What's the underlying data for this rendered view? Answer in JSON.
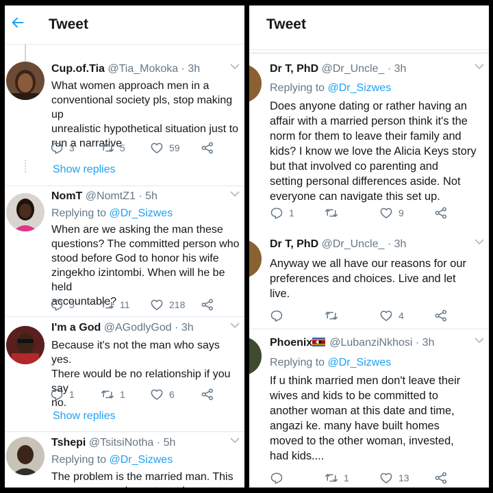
{
  "left": {
    "header": {
      "title": "Tweet"
    },
    "show_replies_label": "Show replies",
    "tweets": [
      {
        "name": "Cup.of.Tia",
        "handle": "@Tia_Mokoka",
        "time": "3h",
        "text": "What women approach men in a\nconventional society pls, stop making up\nunrealistic hypothetical situation just to\nrun a narrative",
        "replies": "3",
        "retweets": "5",
        "likes": "59"
      },
      {
        "name": "NomT",
        "handle": "@NomtZ1",
        "time": "5h",
        "replying_to": "Replying to",
        "reply_handle": "@Dr_Sizwes",
        "text": "When are we asking the man these\nquestions? The committed person who\nstood before God to honor his wife\nzingekho izintombi. When will he be held\naccountable?",
        "replies": "5",
        "retweets": "11",
        "likes": "218"
      },
      {
        "name": "I'm a God",
        "handle": "@AGodlyGod",
        "time": "3h",
        "text": "Because it's not the man who says yes.\nThere would be no relationship if you say\nno.",
        "replies": "1",
        "retweets": "1",
        "likes": "6"
      },
      {
        "name": "Tshepi",
        "handle": "@TsitsiNotha",
        "time": "5h",
        "replying_to": "Replying to",
        "reply_handle": "@Dr_Sizwes",
        "text": "The problem is the married man. This\nman are never honest, not honest to"
      }
    ]
  },
  "right": {
    "header": {
      "title": "Tweet"
    },
    "tweets": [
      {
        "name": "Dr T, PhD",
        "handle": "@Dr_Uncle_",
        "time": "3h",
        "replying_to": "Replying to",
        "reply_handle": "@Dr_Sizwes",
        "text": "Does anyone dating or rather having an\naffair with a married person think it's the\nnorm for them to leave their family and\nkids? I know we love the Alicia Keys story\nbut that involved co parenting and\nsetting personal differences aside. Not\neveryone can navigate this set up.",
        "replies": "1",
        "retweets": "",
        "likes": "9"
      },
      {
        "name": "Dr T, PhD",
        "handle": "@Dr_Uncle_",
        "time": "3h",
        "text": "Anyway we all have our reasons for our\npreferences and choices. Live and let\nlive.",
        "replies": "",
        "retweets": "",
        "likes": "4"
      },
      {
        "name": "Phoenix",
        "handle": "@LubanziNkhosi",
        "time": "3h",
        "replying_to": "Replying to",
        "reply_handle": "@Dr_Sizwes",
        "text": "If u think married men don't leave their\nwives and kids to be committed to\nanother woman at this date and time,\nangazi ke. many have built homes\nmoved to the other woman, invested,\nhad kids....",
        "replies": "",
        "retweets": "1",
        "likes": "13"
      }
    ]
  },
  "colors": {
    "accent": "#1da1f2",
    "secondary_text": "#657786",
    "primary_text": "#14171a",
    "divider": "#e1e8ed"
  }
}
